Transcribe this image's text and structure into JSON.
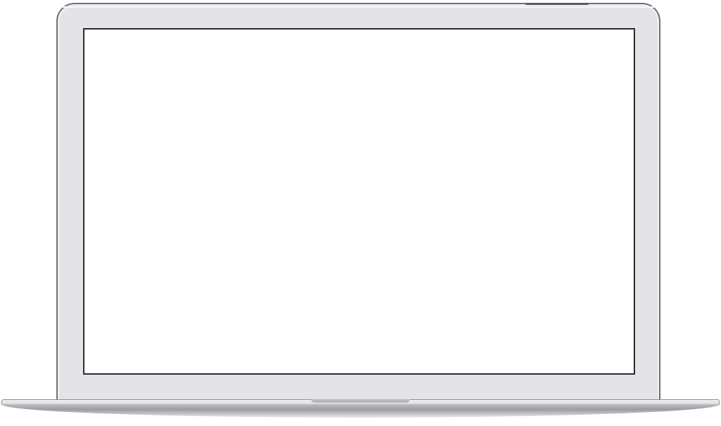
{
  "device": {
    "type": "laptop",
    "screen": {
      "content": ""
    },
    "colors": {
      "bezel": "#e4e3e8",
      "outline": "#6f6f74",
      "screen": "#ffffff",
      "screen_border": "#2b2b2e",
      "base": "#bdbdc2"
    }
  }
}
